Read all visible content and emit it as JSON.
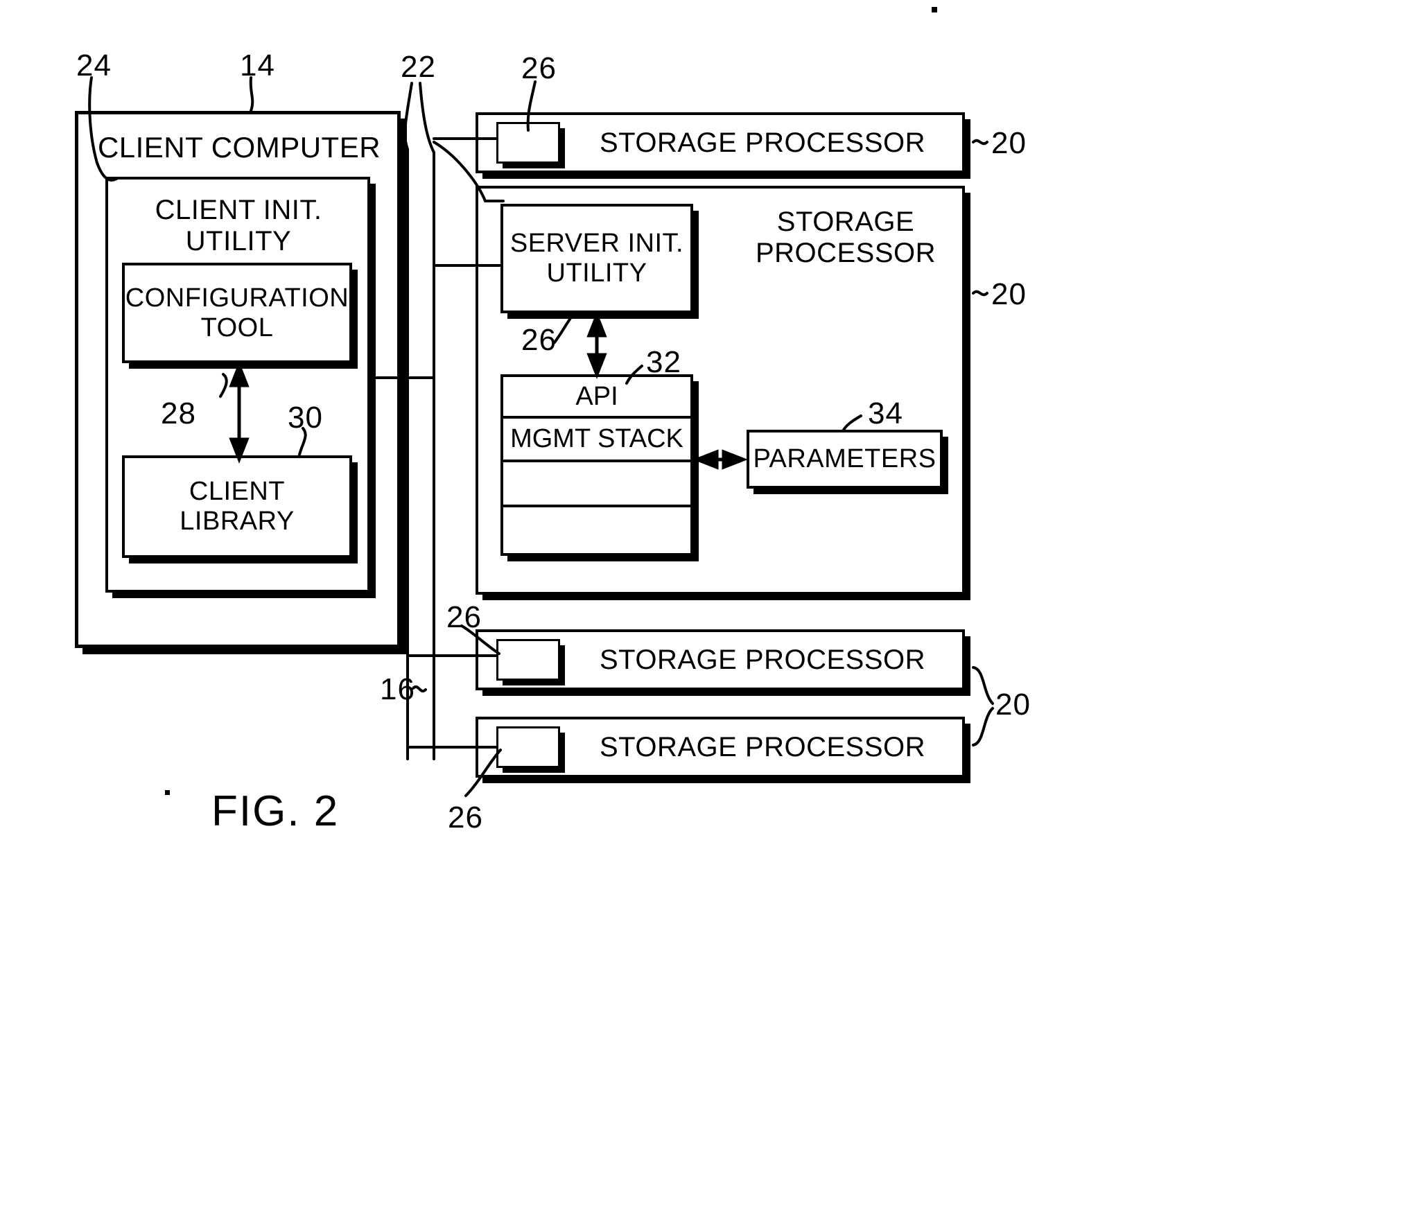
{
  "figure": {
    "title": "FIG. 2",
    "type": "patent-block-diagram"
  },
  "blocks": {
    "client_computer": {
      "label": "CLIENT COMPUTER",
      "ref": "14"
    },
    "client_init_utility": {
      "label": "CLIENT INIT.\nUTILITY",
      "ref": "24"
    },
    "configuration_tool": {
      "label": "CONFIGURATION\nTOOL",
      "ref": "28"
    },
    "client_library": {
      "label": "CLIENT\nLIBRARY",
      "ref": "30"
    },
    "storage_processor_top": {
      "label": "STORAGE PROCESSOR",
      "ref": "20"
    },
    "storage_processor_main": {
      "label": "STORAGE\nPROCESSOR",
      "ref": "20"
    },
    "server_init_utility": {
      "label": "SERVER INIT.\nUTILITY",
      "ref": "26"
    },
    "stack": {
      "ref": "32",
      "rows": [
        {
          "label": "API"
        },
        {
          "label": "MGMT STACK"
        },
        {
          "label": ""
        },
        {
          "label": ""
        }
      ]
    },
    "parameters": {
      "label": "PARAMETERS",
      "ref": "34"
    },
    "storage_processor_third": {
      "label": "STORAGE PROCESSOR",
      "ref": "20"
    },
    "storage_processor_fourth": {
      "label": "STORAGE PROCESSOR",
      "ref": "20"
    }
  },
  "agents": {
    "top": {
      "ref": "26"
    },
    "third": {
      "ref": "26"
    },
    "fourth": {
      "ref": "26"
    }
  },
  "reference_numerals": {
    "n24": "24",
    "n14": "14",
    "n22": "22",
    "n26_top": "26",
    "n20_top": "20",
    "n20_main": "20",
    "n26_server": "26",
    "n32": "32",
    "n34": "34",
    "n28": "28",
    "n30": "30",
    "n26_third": "26",
    "n16": "16",
    "n20_bottom": "20",
    "n26_fourth": "26"
  },
  "colors": {
    "ink": "#000000",
    "paper": "#ffffff"
  }
}
